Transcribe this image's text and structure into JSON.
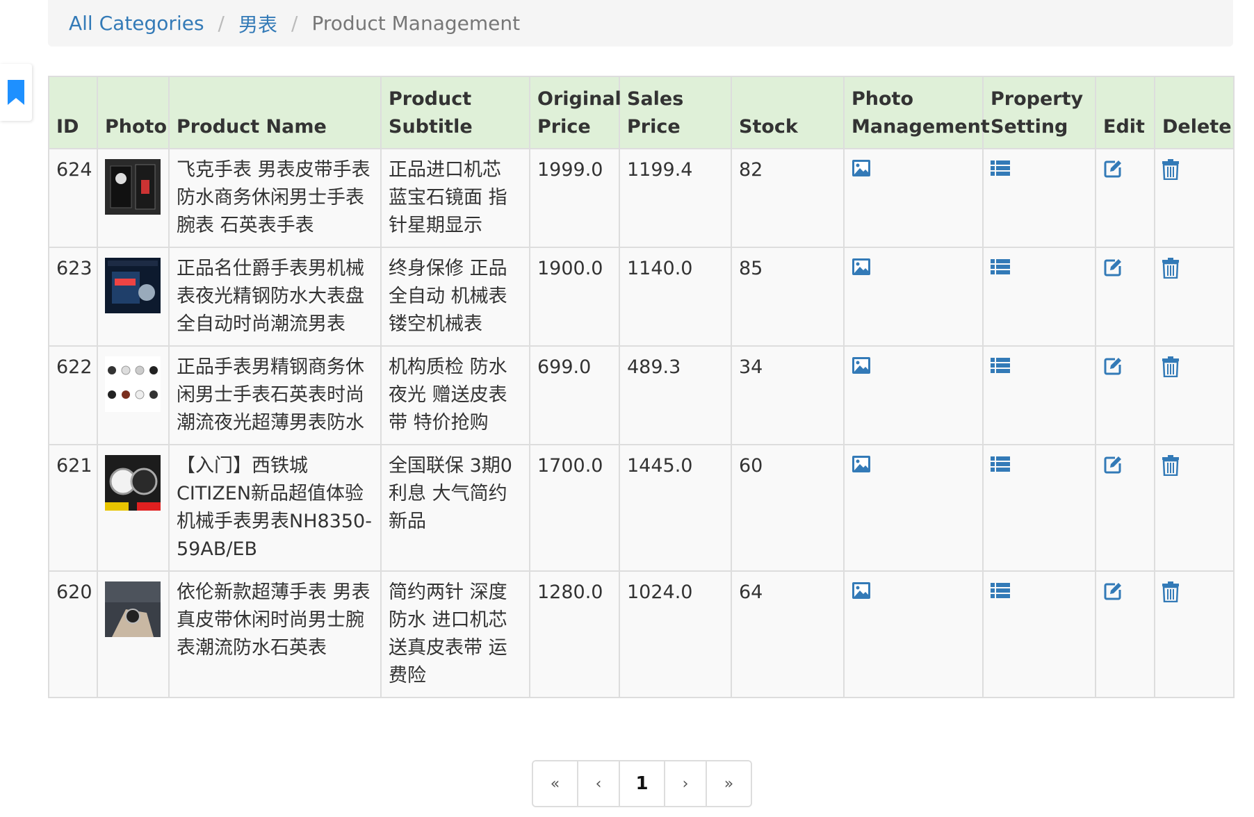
{
  "breadcrumb": {
    "all_categories": "All Categories",
    "category": "男表",
    "current": "Product Management",
    "separator": "/"
  },
  "table": {
    "headers": {
      "id": "ID",
      "photo": "Photo",
      "name": "Product Name",
      "subtitle": "Product Subtitle",
      "original_price": "Original Price",
      "sales_price": "Sales Price",
      "stock": "Stock",
      "photo_management": "Photo Management",
      "property_setting": "Property Setting",
      "edit": "Edit",
      "delete": "Delete"
    },
    "rows": [
      {
        "id": "624",
        "name": "飞克手表 男表皮带手表 防水商务休闲男士手表 腕表 石英表手表",
        "subtitle": "正品进口机芯 蓝宝石镜面 指针星期显示",
        "original_price": "1999.0",
        "sales_price": "1199.4",
        "stock": "82",
        "photo_icon": "watch-box-photo"
      },
      {
        "id": "623",
        "name": "正品名仕爵手表男机械表夜光精钢防水大表盘全自动时尚潮流男表",
        "subtitle": "终身保修 正品全自动 机械表 镂空机械表",
        "original_price": "1900.0",
        "sales_price": "1140.0",
        "stock": "85",
        "photo_icon": "watch-display-photo"
      },
      {
        "id": "622",
        "name": "正品手表男精钢商务休闲男士手表石英表时尚潮流夜光超薄男表防水",
        "subtitle": "机构质检 防水夜光 赠送皮表带 特价抢购",
        "original_price": "699.0",
        "sales_price": "489.3",
        "stock": "34",
        "photo_icon": "watch-grid-photo"
      },
      {
        "id": "621",
        "name": "【入门】西铁城CITIZEN新品超值体验机械手表男表NH8350-59AB/EB",
        "subtitle": "全国联保 3期0利息 大气简约新品",
        "original_price": "1700.0",
        "sales_price": "1445.0",
        "stock": "60",
        "photo_icon": "citizen-watch-photo"
      },
      {
        "id": "620",
        "name": "依伦新款超薄手表 男表真皮带休闲时尚男士腕表潮流防水石英表",
        "subtitle": "简约两针 深度防水 进口机芯 送真皮表带 运费险",
        "original_price": "1280.0",
        "sales_price": "1024.0",
        "stock": "64",
        "photo_icon": "wrist-watch-photo"
      }
    ]
  },
  "pagination": {
    "first": "«",
    "prev": "‹",
    "current": "1",
    "next": "›",
    "last": "»"
  },
  "colors": {
    "link": "#337ab7",
    "header_bg": "#dff0d8",
    "icon": "#337ab7",
    "border": "#dddddd",
    "row_bg": "#f9f9f9"
  }
}
